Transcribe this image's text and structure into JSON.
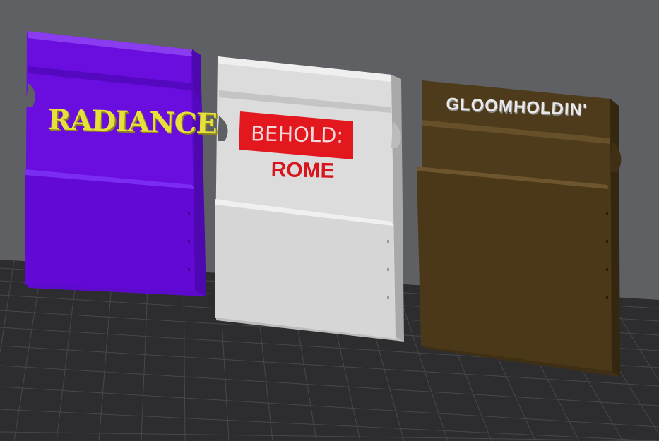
{
  "scene": {
    "background_color": "#5f6063",
    "bed_color": "#2d2d2f",
    "grid_color": "#4a4a4d"
  },
  "holders": [
    {
      "title": "RADIANCE",
      "color": "#6a0ee0",
      "text_color": "#e7df3a"
    },
    {
      "title_top": "BEHOLD:",
      "title_bottom": "ROME",
      "color": "#dcdcdc",
      "label_color": "#e3181f",
      "text_color": "#d8141c"
    },
    {
      "title": "GLOOMHOLDIN'",
      "color": "#4e3b1c",
      "text_color": "#e8e8e8"
    }
  ]
}
